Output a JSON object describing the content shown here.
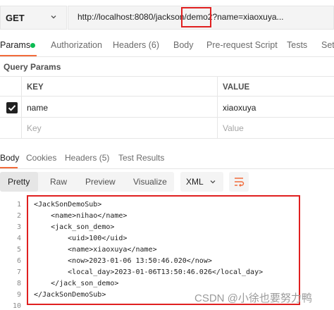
{
  "request": {
    "method": "GET",
    "url": "http://localhost:8080/jackson/demo2?name=xiaoxuya..."
  },
  "request_tabs": [
    {
      "label": "Params",
      "active": true
    },
    {
      "label": "Authorization"
    },
    {
      "label": "Headers (6)"
    },
    {
      "label": "Body"
    },
    {
      "label": "Pre-request Script"
    },
    {
      "label": "Tests"
    },
    {
      "label": "Setti"
    }
  ],
  "query_params": {
    "title": "Query Params",
    "headers": {
      "key": "KEY",
      "value": "VALUE"
    },
    "rows": [
      {
        "checked": true,
        "key": "name",
        "value": "xiaoxuya"
      }
    ],
    "placeholder": {
      "key": "Key",
      "value": "Value"
    }
  },
  "response_tabs": [
    {
      "label": "Body",
      "active": true
    },
    {
      "label": "Cookies"
    },
    {
      "label": "Headers (5)"
    },
    {
      "label": "Test Results"
    }
  ],
  "view_modes": [
    {
      "label": "Pretty",
      "active": true
    },
    {
      "label": "Raw"
    },
    {
      "label": "Preview"
    },
    {
      "label": "Visualize"
    }
  ],
  "format": "XML",
  "code": {
    "line_numbers": [
      "1",
      "2",
      "3",
      "4",
      "5",
      "6",
      "7",
      "8",
      "9",
      "10"
    ],
    "lines": [
      "<JackSonDemoSub>",
      "    <name>nihao</name>",
      "    <jack_son_demo>",
      "        <uid>100</uid>",
      "        <name>xiaoxuya</name>",
      "        <now>2023-01-06 13:50:46.020</now>",
      "        <local_day>2023-01-06T13:50:46.026</local_day>",
      "    </jack_son_demo>",
      "</JackSonDemoSub>",
      ""
    ]
  },
  "watermark": "CSDN @小徐也要努力鸭",
  "colors": {
    "accent": "#f26b3a",
    "highlight_box": "#e02020",
    "status_dot": "#0cbb52"
  }
}
